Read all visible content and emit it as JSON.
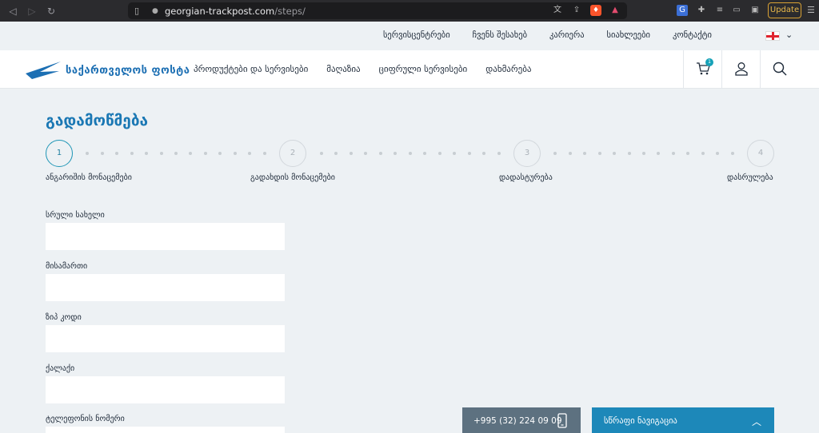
{
  "browser": {
    "url_host": "georgian-trackpost.com",
    "url_path": "/steps/",
    "update_label": "Update"
  },
  "topbar": {
    "links": [
      "სერვისცენტრები",
      "ჩვენს შესახებ",
      "კარიერა",
      "სიახლეები",
      "კონტაქტი"
    ]
  },
  "header": {
    "logo_text": "საქართველოს ფოსტა",
    "nav": [
      "პროდუქტები და სერვისები",
      "მაღაზია",
      "ციფრული სერვისები",
      "დახმარება"
    ],
    "cart_count": "1"
  },
  "page": {
    "title": "გადამოწმება",
    "steps": [
      {
        "number": "1",
        "label": "ანგარიშის მონაცემები"
      },
      {
        "number": "2",
        "label": "გადახდის მონაცემები"
      },
      {
        "number": "3",
        "label": "დადასტურება"
      },
      {
        "number": "4",
        "label": "დასრულება"
      }
    ],
    "active_step": 1,
    "fields": [
      {
        "label": "სრული სახელი",
        "value": ""
      },
      {
        "label": "მისამართი",
        "value": ""
      },
      {
        "label": "ზიპ კოდი",
        "value": ""
      },
      {
        "label": "ქალაქი",
        "value": ""
      },
      {
        "label": "ტელეფონის ნომერი",
        "value": ""
      }
    ]
  },
  "footer": {
    "phone": "+995 (32) 224 09 09",
    "quick_nav": "სწრაფი ნავიგაცია"
  },
  "colors": {
    "brand_blue": "#1b78b4",
    "teal": "#1f96b6",
    "quicknav_bg": "#1d88b9",
    "phonebar_bg": "#5d7180"
  }
}
